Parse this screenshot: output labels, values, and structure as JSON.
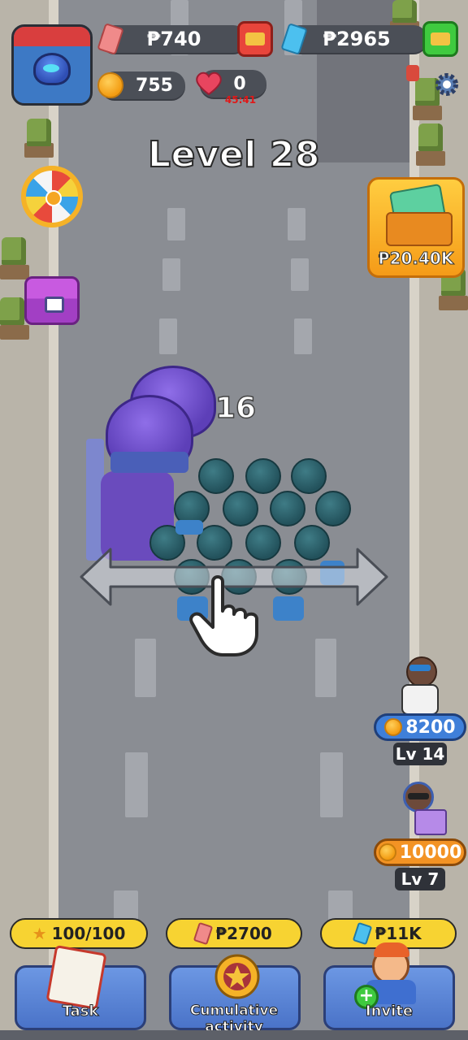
{
  "hud": {
    "cash_value": "₱740",
    "money_value": "₱2965",
    "coins_value": "755",
    "lives_value": "0",
    "lives_timer": "45:41"
  },
  "level": {
    "title": "Level 28"
  },
  "army": {
    "count": "16"
  },
  "atm": {
    "price": "₱20.40K"
  },
  "recruits": [
    {
      "price": "8200",
      "level": "Lv 14"
    },
    {
      "price": "10000",
      "level": "Lv 7"
    }
  ],
  "bottom_actions": [
    {
      "price": "100/100",
      "label": "Task"
    },
    {
      "price": "₱2700",
      "label": "Cumulative activity"
    },
    {
      "price": "₱11K",
      "label": "Invite"
    }
  ],
  "colors": {
    "road": "#8a8d93",
    "hud_bar": "#4b4f57",
    "accent_yellow": "#f7d332",
    "button_blue": "#4a73c8",
    "recruit_blue": "#3f7fd9",
    "recruit_orange": "#f39324"
  }
}
